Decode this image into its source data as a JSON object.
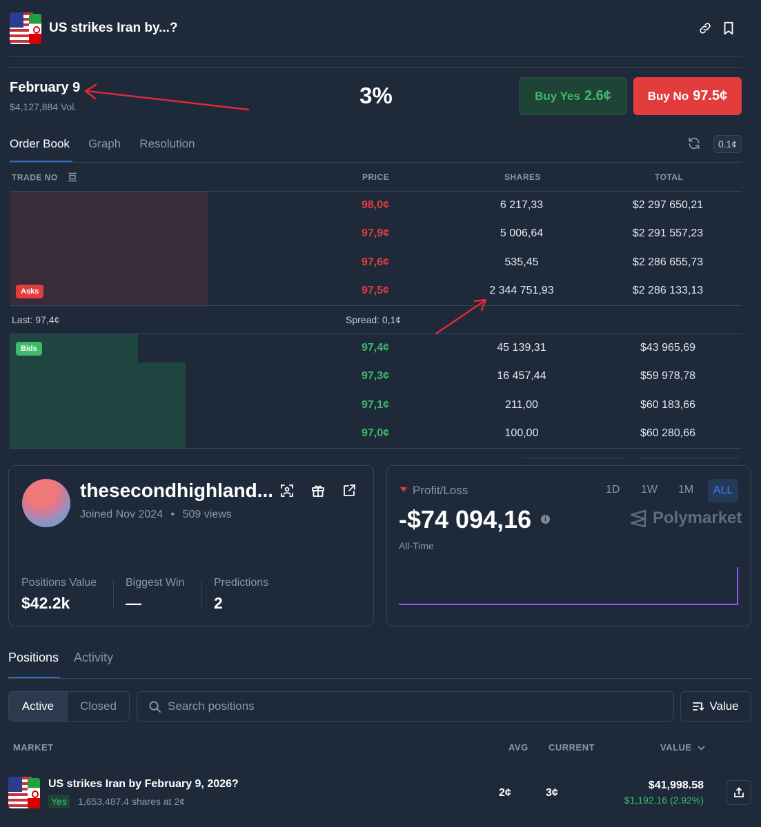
{
  "header": {
    "title": "US strikes Iran by...?",
    "icons": [
      "link-icon",
      "bookmark-icon"
    ]
  },
  "market": {
    "date": "February 9",
    "volume": "$4,127,884 Vol.",
    "chance": "3%",
    "buy_yes_label": "Buy Yes",
    "buy_yes_price": "2.6¢",
    "buy_no_label": "Buy No",
    "buy_no_price": "97.5¢"
  },
  "tabs": [
    {
      "label": "Order Book",
      "active": true
    },
    {
      "label": "Graph",
      "active": false
    },
    {
      "label": "Resolution",
      "active": false
    }
  ],
  "tick_size": "0.1¢",
  "order_book": {
    "headers": {
      "trade": "TRADE NO",
      "price": "PRICE",
      "shares": "SHARES",
      "total": "TOTAL"
    },
    "asks_label": "Asks",
    "bids_label": "Bids",
    "asks": [
      {
        "price": "98,0¢",
        "shares": "6 217,33",
        "total": "$2 297 650,21"
      },
      {
        "price": "97,9¢",
        "shares": "5 006,64",
        "total": "$2 291 557,23"
      },
      {
        "price": "97,6¢",
        "shares": "535,45",
        "total": "$2 286 655,73"
      },
      {
        "price": "97,5¢",
        "shares": "2 344 751,93",
        "total": "$2 286 133,13"
      }
    ],
    "last": "Last: 97,4¢",
    "spread": "Spread: 0,1¢",
    "bids": [
      {
        "price": "97,4¢",
        "shares": "45 139,31",
        "total": "$43 965,69"
      },
      {
        "price": "97,3¢",
        "shares": "16 457,44",
        "total": "$59 978,78"
      },
      {
        "price": "97,1¢",
        "shares": "211,00",
        "total": "$60 183,66"
      },
      {
        "price": "97,0¢",
        "shares": "100,00",
        "total": "$60 280,66"
      }
    ],
    "depth": {
      "asks_cumulative_fraction": 0.96,
      "bids_fractions": [
        0.62,
        0.85,
        0.85,
        0.85
      ]
    }
  },
  "profile": {
    "username": "thesecondhighland...",
    "joined": "Joined Nov 2024",
    "views": "509 views",
    "stats": [
      {
        "label": "Positions Value",
        "value": "$42.2k"
      },
      {
        "label": "Biggest Win",
        "value": "—"
      },
      {
        "label": "Predictions",
        "value": "2"
      }
    ]
  },
  "pnl": {
    "label": "Profit/Loss",
    "ranges": [
      "1D",
      "1W",
      "1M",
      "ALL"
    ],
    "active_range": "ALL",
    "value": "-$74 094,16",
    "period": "All-Time",
    "brand": "Polymarket",
    "line_color": "#8b5cf6"
  },
  "positions": {
    "tabs": [
      {
        "label": "Positions",
        "active": true
      },
      {
        "label": "Activity",
        "active": false
      }
    ],
    "filters": {
      "active": "Active",
      "closed": "Closed"
    },
    "search_placeholder": "Search positions",
    "sort_label": "Value",
    "columns": {
      "market": "MARKET",
      "avg": "AVG",
      "current": "CURRENT",
      "value": "VALUE"
    },
    "rows": [
      {
        "title": "US strikes Iran by February 9, 2026?",
        "outcome": "Yes",
        "shares": "1,653,487.4 shares at 2¢",
        "avg": "2¢",
        "current": "3¢",
        "value": "$41,998.58",
        "change": "$1,192.16 (2.92%)"
      }
    ]
  },
  "colors": {
    "background": "#1e2a3a",
    "green": "#3ebb6a",
    "red": "#e23c3c",
    "accent": "#3b82f6",
    "annotation": "#e0283a"
  }
}
